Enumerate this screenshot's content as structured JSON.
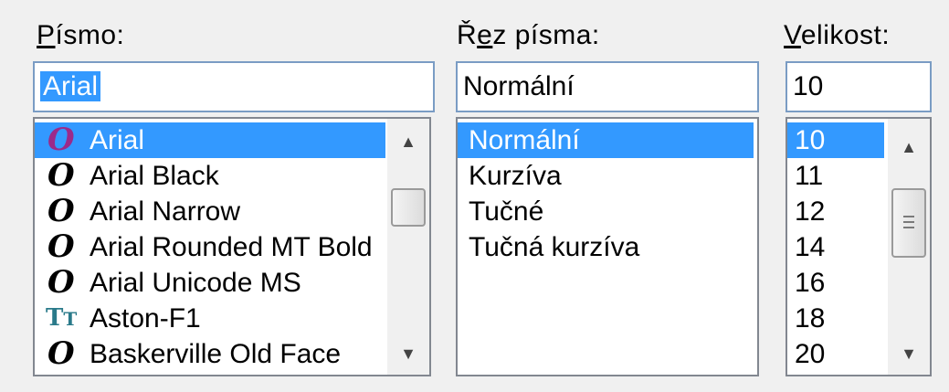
{
  "font": {
    "label": "Písmo:",
    "label_key": "P",
    "label_rest": "ísmo:",
    "value": "Arial",
    "items": [
      {
        "name": "Arial",
        "icon": "opentype-icon",
        "selected": true
      },
      {
        "name": "Arial Black",
        "icon": "opentype-icon"
      },
      {
        "name": "Arial Narrow",
        "icon": "opentype-icon"
      },
      {
        "name": "Arial Rounded MT Bold",
        "icon": "opentype-icon"
      },
      {
        "name": "Arial Unicode MS",
        "icon": "opentype-icon"
      },
      {
        "name": "Aston-F1",
        "icon": "truetype-icon"
      },
      {
        "name": "Baskerville Old Face",
        "icon": "opentype-icon"
      }
    ],
    "scroll_up": "▲",
    "scroll_down": "▼"
  },
  "style": {
    "label_a": "Ř",
    "label_key": "e",
    "label_b": "z písma:",
    "value": "Normální",
    "items": [
      "Normální",
      "Kurzíva",
      "Tučné",
      "Tučná kurzíva"
    ],
    "selected_index": 0
  },
  "size": {
    "label_key": "V",
    "label_rest": "elikost:",
    "value": "10",
    "items": [
      "10",
      "11",
      "12",
      "14",
      "16",
      "18",
      "20"
    ],
    "selected_index": 0,
    "scroll_up": "▲",
    "scroll_down": "▼"
  },
  "colors": {
    "selection": "#3399ff",
    "opentype_selected": "#9b2a8a",
    "truetype": "#2a7a8a"
  }
}
